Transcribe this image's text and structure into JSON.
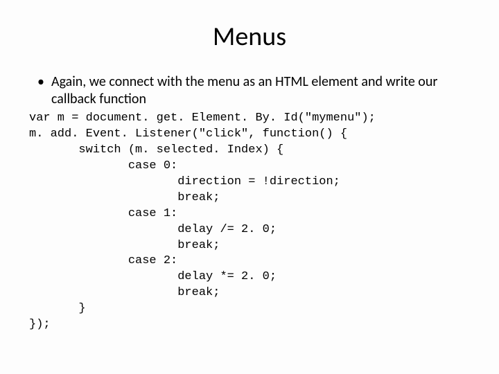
{
  "title": "Menus",
  "bullet": "Again, we connect with the menu as an HTML element and write our callback function",
  "code": "var m = document. get. Element. By. Id(\"mymenu\");\nm. add. Event. Listener(\"click\", function() {\n       switch (m. selected. Index) {\n              case 0:\n                     direction = !direction;\n                     break;\n              case 1:\n                     delay /= 2. 0;\n                     break;\n              case 2:\n                     delay *= 2. 0;\n                     break;\n       }\n});"
}
